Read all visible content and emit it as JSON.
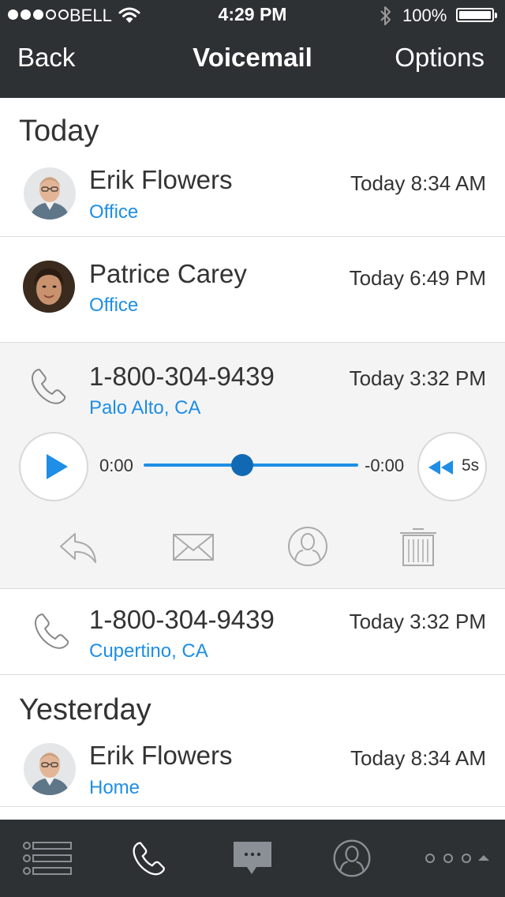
{
  "status_bar": {
    "carrier": "BELL",
    "time": "4:29 PM",
    "battery": "100%",
    "signal_strength": 3,
    "signal_total": 5
  },
  "nav": {
    "back_label": "Back",
    "title": "Voicemail",
    "options_label": "Options"
  },
  "sections": {
    "today": "Today",
    "yesterday": "Yesterday"
  },
  "voicemails": [
    {
      "name": "Erik Flowers",
      "sub": "Office",
      "time": "Today 8:34 AM",
      "icon": "avatar"
    },
    {
      "name": "Patrice Carey",
      "sub": "Office",
      "time": "Today 6:49 PM",
      "icon": "avatar"
    },
    {
      "name": "1-800-304-9439",
      "sub": "Palo Alto, CA",
      "time": "Today 3:32 PM",
      "icon": "phone-icon"
    },
    {
      "name": "1-800-304-9439",
      "sub": "Cupertino, CA",
      "time": "Today 3:32 PM",
      "icon": "phone-icon"
    },
    {
      "name": "Erik Flowers",
      "sub": "Home",
      "time": "Today 8:34 AM",
      "icon": "avatar"
    }
  ],
  "player": {
    "elapsed": "0:00",
    "remaining": "-0:00",
    "rewind_label": "5s",
    "progress_fraction": 0.46
  },
  "actions": [
    "reply-icon",
    "envelope-icon",
    "contact-icon",
    "trash-icon"
  ],
  "tab_bar": [
    "list-icon",
    "phone-icon",
    "chat-icon",
    "contact-icon",
    "more-icon"
  ],
  "colors": {
    "header_bg": "#2d3133",
    "accent": "#1e8ee6",
    "knob": "#1269b3",
    "expanded_bg": "#f4f4f4"
  }
}
